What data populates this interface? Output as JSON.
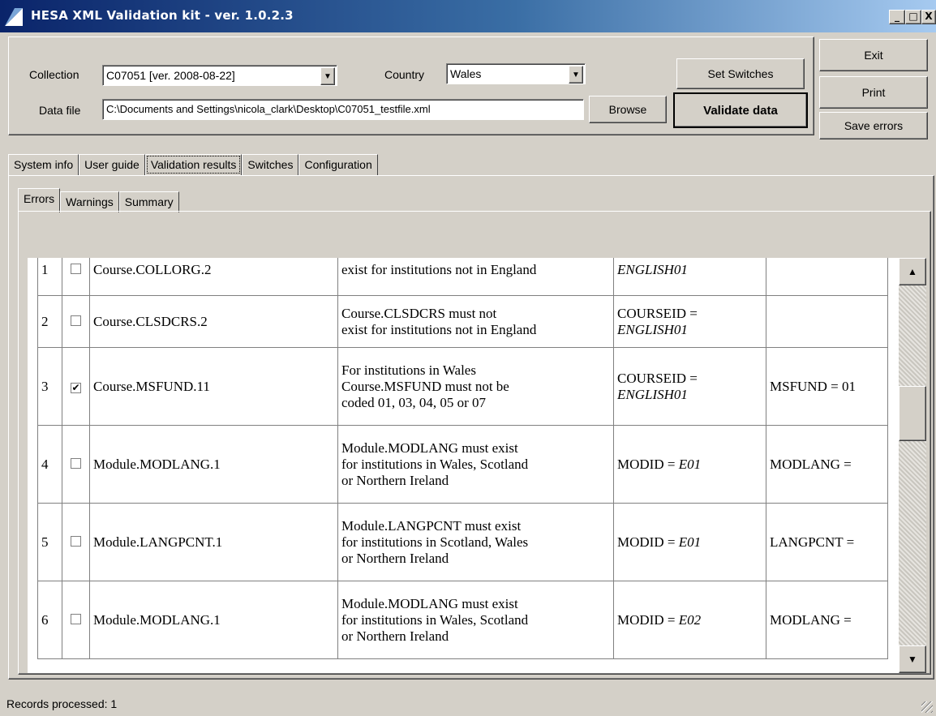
{
  "window": {
    "title": "HESA XML Validation kit - ver. 1.0.2.3",
    "minimize": "_",
    "maximize": "□",
    "close": "X"
  },
  "form": {
    "collection_label": "Collection",
    "collection_value": "C07051 [ver. 2008-08-22]",
    "country_label": "Country",
    "country_value": "Wales",
    "datafile_label": "Data file",
    "datafile_value": "C:\\Documents and Settings\\nicola_clark\\Desktop\\C07051_testfile.xml",
    "browse": "Browse",
    "set_switches": "Set Switches",
    "validate": "Validate data",
    "exit": "Exit",
    "print": "Print",
    "save_errors": "Save errors"
  },
  "main_tabs": [
    "System info",
    "User guide",
    "Validation results",
    "Switches",
    "Configuration"
  ],
  "sub_tabs": [
    "Errors",
    "Warnings",
    "Summary"
  ],
  "rows": [
    {
      "n": "1",
      "checked": false,
      "rule": "Course.COLLORG.2",
      "desc": [
        "exist for institutions not in England"
      ],
      "key": "",
      "key_val": "ENGLISH01",
      "extra": ""
    },
    {
      "n": "2",
      "checked": false,
      "rule": "Course.CLSDCRS.2",
      "desc": [
        "Course.CLSDCRS must not",
        "exist for institutions not in England"
      ],
      "key": "COURSEID =",
      "key_val": "ENGLISH01",
      "extra": ""
    },
    {
      "n": "3",
      "checked": true,
      "rule": "Course.MSFUND.11",
      "desc": [
        "For institutions in Wales",
        "Course.MSFUND must not be",
        "coded 01, 03, 04, 05 or 07"
      ],
      "key": "COURSEID =",
      "key_val": "ENGLISH01",
      "extra": "MSFUND = 01"
    },
    {
      "n": "4",
      "checked": false,
      "rule": "Module.MODLANG.1",
      "desc": [
        "Module.MODLANG must exist",
        "for institutions in Wales, Scotland",
        "or Northern Ireland"
      ],
      "key": "MODID = ",
      "key_val": "E01",
      "extra": "MODLANG ="
    },
    {
      "n": "5",
      "checked": false,
      "rule": "Module.LANGPCNT.1",
      "desc": [
        "Module.LANGPCNT must exist",
        "for institutions in Scotland, Wales",
        "or Northern Ireland"
      ],
      "key": "MODID = ",
      "key_val": "E01",
      "extra": "LANGPCNT ="
    },
    {
      "n": "6",
      "checked": false,
      "rule": "Module.MODLANG.1",
      "desc": [
        "Module.MODLANG must exist",
        "for institutions in Wales, Scotland",
        "or Northern Ireland"
      ],
      "key": "MODID = ",
      "key_val": "E02",
      "extra": "MODLANG ="
    }
  ],
  "scroll": {
    "up": "▲",
    "down": "▼"
  },
  "status": "Records processed: 1",
  "colors": {
    "titlebar_start": "#0a246a",
    "face": "#d4d0c8"
  }
}
